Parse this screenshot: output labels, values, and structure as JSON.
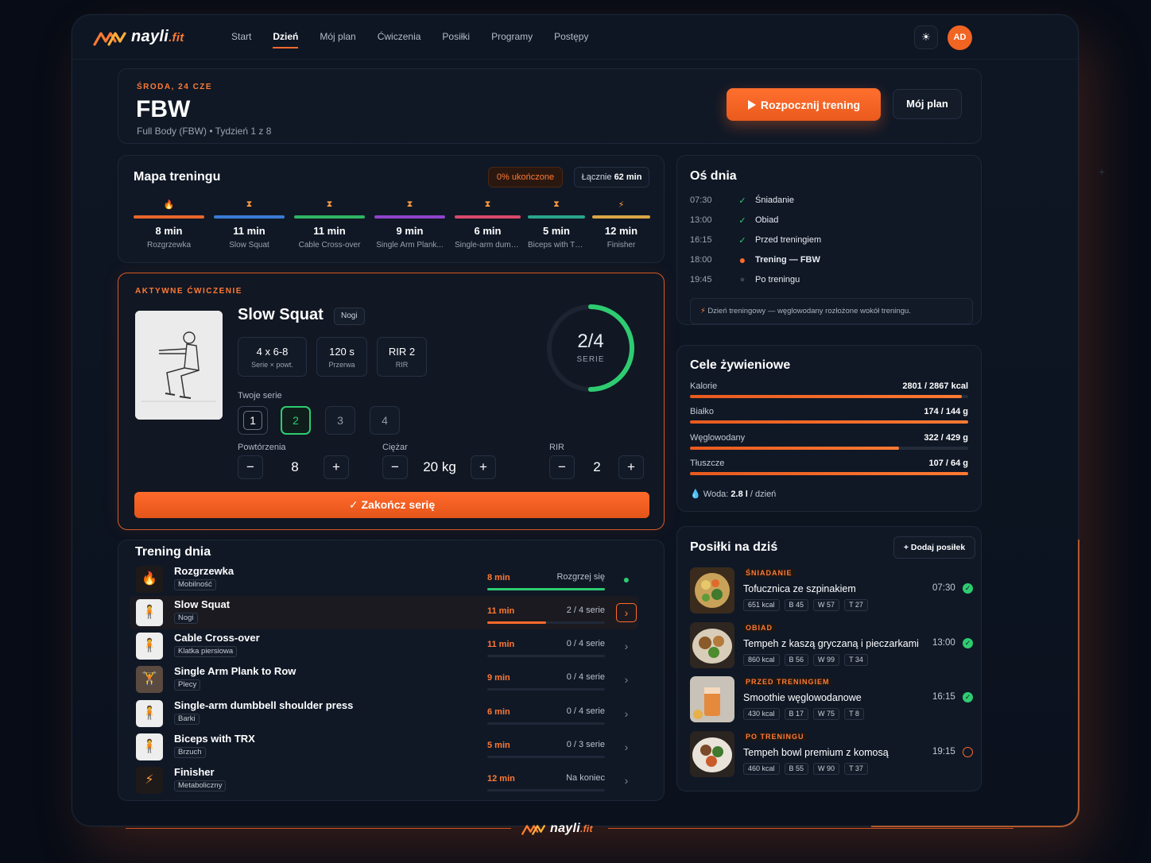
{
  "app": {
    "brand": "nayli",
    "brand_suffix": ".fit",
    "nav": [
      "Start",
      "Dzień",
      "Mój plan",
      "Ćwiczenia",
      "Posiłki",
      "Programy",
      "Postępy"
    ],
    "active_nav": "Dzień",
    "theme_icon": "sun-icon",
    "avatar": "AD"
  },
  "header": {
    "date": "ŚRODA, 24 CZE",
    "title": "FBW",
    "subtitle": "Full Body (FBW) • Tydzień 1 z 8",
    "start_button": "Rozpocznij trening",
    "plan_button": "Mój plan"
  },
  "map": {
    "title": "Mapa treningu",
    "completed": "0% ukończone",
    "total_label": "Łącznie",
    "total_value": "62 min",
    "segments": [
      {
        "min": "8 min",
        "name": "Rozgrzewka",
        "icon": "flame-icon",
        "color": "#e8662c"
      },
      {
        "min": "11 min",
        "name": "Slow Squat",
        "icon": "dumbbell-icon",
        "color": "#3a7bd5"
      },
      {
        "min": "11 min",
        "name": "Cable Cross-over",
        "icon": "dumbbell-icon",
        "color": "#2fb463"
      },
      {
        "min": "9 min",
        "name": "Single Arm Plank...",
        "icon": "dumbbell-icon",
        "color": "#8e44c9"
      },
      {
        "min": "6 min",
        "name": "Single-arm dumb...",
        "icon": "dumbbell-icon",
        "color": "#d94a6a"
      },
      {
        "min": "5 min",
        "name": "Biceps with TRX",
        "icon": "dumbbell-icon",
        "color": "#2aa68a"
      },
      {
        "min": "12 min",
        "name": "Finisher",
        "icon": "bolt-icon",
        "color": "#d9a645"
      }
    ]
  },
  "active": {
    "label": "AKTYWNE ĆWICZENIE",
    "name": "Slow Squat",
    "tag": "Nogi",
    "stats": [
      {
        "value": "4 x 6-8",
        "label": "Serie × powt."
      },
      {
        "value": "120 s",
        "label": "Przerwa"
      },
      {
        "value": "RIR 2",
        "label": "RIR"
      }
    ],
    "progress_text": "2/4",
    "progress_label": "SERIE",
    "progress_fraction": 0.5,
    "sets_label": "Twoje serie",
    "sets": [
      "1",
      "2",
      "3",
      "4"
    ],
    "reps_label": "Powtórzenia",
    "reps": "8",
    "weight_label": "Ciężar",
    "weight": "20 kg",
    "rir_label": "RIR",
    "rir": "2",
    "minus": "−",
    "plus": "+",
    "finish_button": "Zakończ serię"
  },
  "plan": {
    "title": "Trening dnia",
    "rows": [
      {
        "name": "Rozgrzewka",
        "tag": "Mobilność",
        "min": "8 min",
        "status": "Rozgrzej się",
        "progress": 1.0
      },
      {
        "name": "Slow Squat",
        "tag": "Nogi",
        "min": "11 min",
        "status": "2 / 4 serie",
        "progress": 0.5
      },
      {
        "name": "Cable Cross-over",
        "tag": "Klatka piersiowa",
        "min": "11 min",
        "status": "0 / 4 serie",
        "progress": 0
      },
      {
        "name": "Single Arm Plank to Row",
        "tag": "Plecy",
        "min": "9 min",
        "status": "0 / 4 serie",
        "progress": 0
      },
      {
        "name": "Single-arm dumbbell shoulder press",
        "tag": "Barki",
        "min": "6 min",
        "status": "0 / 4 serie",
        "progress": 0
      },
      {
        "name": "Biceps with TRX",
        "tag": "Brzuch",
        "min": "5 min",
        "status": "0 / 3 serie",
        "progress": 0
      },
      {
        "name": "Finisher",
        "tag": "Metaboliczny",
        "min": "12 min",
        "status": "Na koniec",
        "progress": 0
      }
    ]
  },
  "timeline": {
    "title": "Oś dnia",
    "items": [
      {
        "time": "07:30",
        "label": "Śniadanie",
        "state": "done"
      },
      {
        "time": "13:00",
        "label": "Obiad",
        "state": "done"
      },
      {
        "time": "16:15",
        "label": "Przed treningiem",
        "state": "done"
      },
      {
        "time": "18:00",
        "label": "Trening — FBW",
        "state": "current"
      },
      {
        "time": "19:45",
        "label": "Po treningu",
        "state": "pending"
      }
    ],
    "note": "Dzień treningowy — węglowodany rozłożone wokół treningu."
  },
  "nutrition": {
    "title": "Cele żywieniowe",
    "rows": [
      {
        "label": "Kalorie",
        "value": "2801 / 2867 kcal",
        "fraction": 0.977
      },
      {
        "label": "Białko",
        "value": "174 / 144 g",
        "fraction": 1.0
      },
      {
        "label": "Węglowodany",
        "value": "322 / 429 g",
        "fraction": 0.751
      },
      {
        "label": "Tłuszcze",
        "value": "107 / 64 g",
        "fraction": 1.0
      }
    ],
    "water_label": "Woda:",
    "water_value": "2.8 l",
    "water_unit": "/ dzień"
  },
  "meals": {
    "title": "Posiłki na dziś",
    "add_button": "Dodaj posiłek",
    "items": [
      {
        "category": "ŚNIADANIE",
        "name": "Tofucznica ze szpinakiem",
        "time": "07:30",
        "done": true,
        "tags": [
          "651 kcal",
          "B 45",
          "W 57",
          "T 27"
        ]
      },
      {
        "category": "OBIAD",
        "name": "Tempeh z kaszą gryczaną i pieczarkami",
        "time": "13:00",
        "done": true,
        "tags": [
          "860 kcal",
          "B 56",
          "W 99",
          "T 34"
        ]
      },
      {
        "category": "PRZED TRENINGIEM",
        "name": "Smoothie węglowodanowe",
        "time": "16:15",
        "done": true,
        "tags": [
          "430 kcal",
          "B 17",
          "W 75",
          "T 8"
        ]
      },
      {
        "category": "PO TRENINGU",
        "name": "Tempeh bowl premium z komosą",
        "time": "19:15",
        "done": false,
        "tags": [
          "460 kcal",
          "B 55",
          "W 90",
          "T 37"
        ]
      }
    ]
  }
}
